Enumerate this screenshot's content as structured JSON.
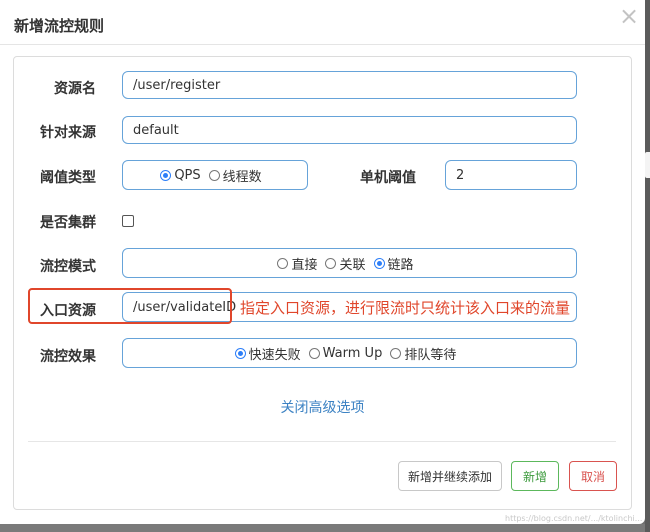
{
  "dialog": {
    "title": "新增流控规则",
    "close_icon": "×"
  },
  "form": {
    "resource": {
      "label": "资源名",
      "value": "/user/register"
    },
    "origin": {
      "label": "针对来源",
      "value": "default"
    },
    "threshold_type": {
      "label": "阈值类型",
      "options": [
        "QPS",
        "线程数"
      ],
      "selected": "QPS"
    },
    "single_threshold": {
      "label": "单机阈值",
      "value": "2"
    },
    "cluster": {
      "label": "是否集群",
      "checked": false
    },
    "flow_mode": {
      "label": "流控模式",
      "options": [
        "直接",
        "关联",
        "链路"
      ],
      "selected": "链路"
    },
    "entry_resource": {
      "label": "入口资源",
      "value": "/user/validateID"
    },
    "control_effect": {
      "label": "流控效果",
      "options": [
        "快速失败",
        "Warm Up",
        "排队等待"
      ],
      "selected": "快速失败"
    },
    "advanced_link": "关闭高级选项"
  },
  "annotation": {
    "text": "指定入口资源，进行限流时只统计该入口来的流量",
    "color": "#e0462b"
  },
  "footer": {
    "continue_add": "新增并继续添加",
    "add": "新增",
    "cancel": "取消"
  },
  "watermark": "https://blog.csdn.net/.../ktolinchi..."
}
